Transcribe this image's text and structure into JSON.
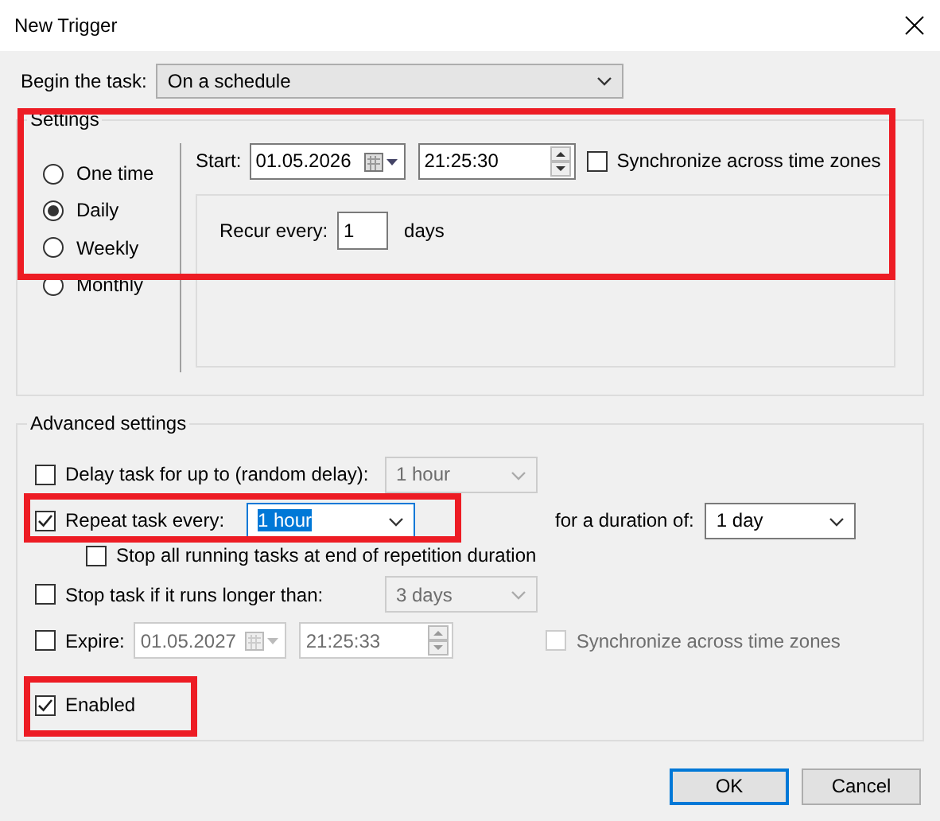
{
  "window": {
    "title": "New Trigger"
  },
  "begin": {
    "label": "Begin the task:",
    "value": "On a schedule"
  },
  "settings": {
    "title": "Settings",
    "highlighted": true,
    "options": [
      {
        "label": "One time",
        "selected": false
      },
      {
        "label": "Daily",
        "selected": true
      },
      {
        "label": "Weekly",
        "selected": false
      },
      {
        "label": "Monthly",
        "selected": false
      }
    ],
    "start": {
      "label": "Start:",
      "date": "01.05.2026",
      "time": "21:25:30",
      "sync": {
        "label": "Synchronize across time zones",
        "checked": false
      }
    },
    "recur": {
      "label": "Recur every:",
      "value": "1",
      "unit": "days"
    }
  },
  "advanced": {
    "title": "Advanced settings",
    "delay": {
      "label": "Delay task for up to (random delay):",
      "checked": false,
      "value": "1 hour",
      "disabled": true
    },
    "repeat": {
      "label": "Repeat task every:",
      "checked": true,
      "value": "1 hour",
      "highlighted": true,
      "duration_label": "for a duration of:",
      "duration": "1 day"
    },
    "stop_all": {
      "label": "Stop all running tasks at end of repetition duration",
      "checked": false
    },
    "stop_longer": {
      "label": "Stop task if it runs longer than:",
      "checked": false,
      "value": "3 days",
      "disabled": true
    },
    "expire": {
      "label": "Expire:",
      "checked": false,
      "date": "01.05.2027",
      "time": "21:25:33",
      "disabled": true,
      "sync": {
        "label": "Synchronize across time zones",
        "checked": false,
        "disabled": true
      }
    },
    "enabled": {
      "label": "Enabled",
      "checked": true,
      "highlighted": true
    }
  },
  "buttons": [
    {
      "label": "OK",
      "default": true
    },
    {
      "label": "Cancel",
      "default": false
    }
  ]
}
